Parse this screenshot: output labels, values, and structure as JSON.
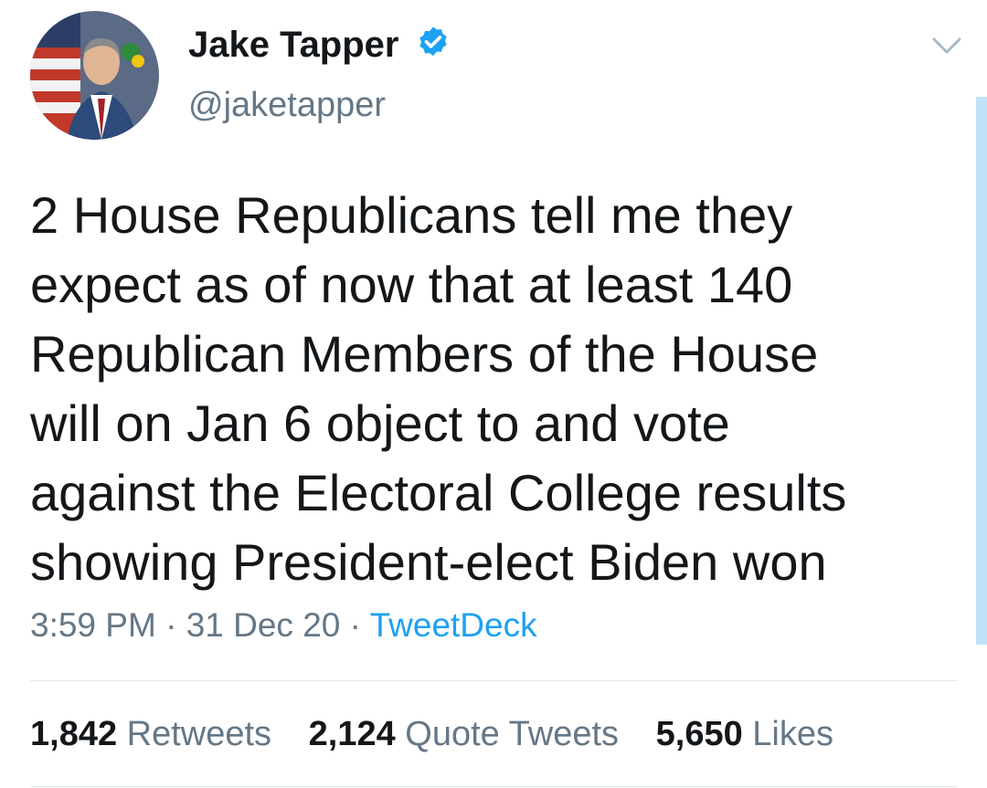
{
  "user": {
    "display_name": "Jake Tapper",
    "handle": "@jaketapper",
    "verified": true
  },
  "tweet": {
    "text_lines": [
      "2 House Republicans tell me they",
      "expect as of now that at least 140",
      "Republican Members of the House",
      "will on Jan 6 object to and vote",
      "against the Electoral College results",
      "showing President-elect Biden won"
    ],
    "time": "3:59 PM",
    "separator": "·",
    "date": "31 Dec 20",
    "source": "TweetDeck"
  },
  "stats": {
    "retweets_count": "1,842",
    "retweets_label": "Retweets",
    "quotes_count": "2,124",
    "quotes_label": "Quote Tweets",
    "likes_count": "5,650",
    "likes_label": "Likes"
  },
  "icons": {
    "verified": "verified-badge-icon",
    "more": "chevron-down-icon"
  },
  "colors": {
    "verified_blue": "#1da1f2",
    "link_blue": "#1da1f2",
    "secondary_text": "#657786",
    "primary_text": "#14171a"
  }
}
